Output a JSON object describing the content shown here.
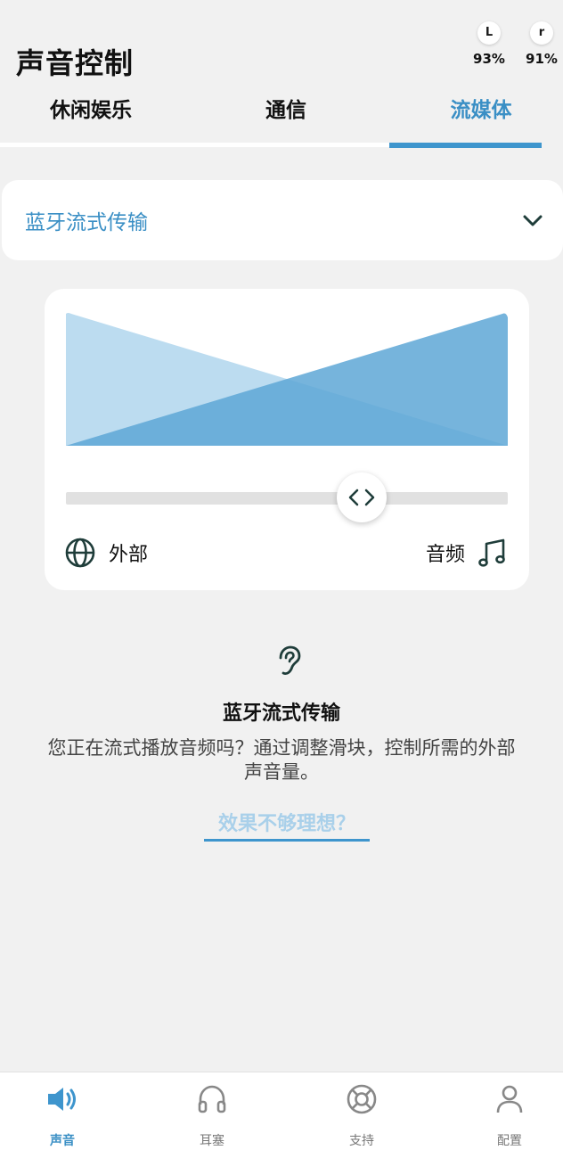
{
  "header": {
    "title": "声音控制",
    "battery": {
      "left": {
        "label": "L",
        "percent": "93%"
      },
      "right": {
        "label": "r",
        "percent": "91%"
      }
    }
  },
  "tabs": [
    {
      "label": "休闲娱乐",
      "active": false
    },
    {
      "label": "通信",
      "active": false
    },
    {
      "label": "流媒体",
      "active": true
    }
  ],
  "program_dropdown": {
    "selected": "蓝牙流式传输",
    "icon": "chevron-down-icon"
  },
  "balance": {
    "position": 0.67,
    "left_label": "外部",
    "left_icon": "globe-icon",
    "right_label": "音频",
    "right_icon": "music-note-icon"
  },
  "info": {
    "icon": "ear-icon",
    "title": "蓝牙流式传输",
    "description": "您正在流式播放音频吗？通过调整滑块，控制所需的外部声音量。",
    "link": "效果不够理想？"
  },
  "bottom_nav": [
    {
      "label": "声音",
      "icon": "speaker-icon",
      "active": true
    },
    {
      "label": "耳塞",
      "icon": "headphones-icon",
      "active": false
    },
    {
      "label": "支持",
      "icon": "lifebuoy-icon",
      "active": false
    },
    {
      "label": "配置",
      "icon": "user-icon",
      "active": false
    }
  ],
  "colors": {
    "accent": "#3e95cd",
    "background": "#f1f1f1",
    "viz_light": "#bcdcf0",
    "viz_dark": "#5ea7d6"
  }
}
